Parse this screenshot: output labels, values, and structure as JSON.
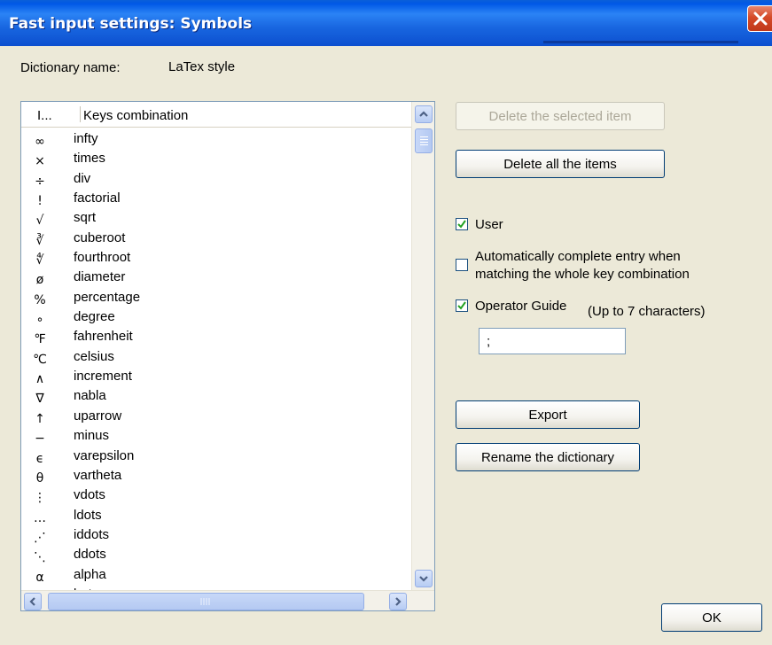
{
  "window": {
    "title": "Fast input settings: Symbols"
  },
  "dictionary": {
    "name_label": "Dictionary name:",
    "name_value": "LaTex style"
  },
  "list": {
    "columns": [
      "I...",
      "Keys combination"
    ],
    "rows": [
      {
        "symbol": "∞",
        "key": "infty"
      },
      {
        "symbol": "×",
        "key": "times"
      },
      {
        "symbol": "÷",
        "key": "div"
      },
      {
        "symbol": "!",
        "key": "factorial"
      },
      {
        "symbol": "√",
        "key": "sqrt"
      },
      {
        "symbol": "∛",
        "key": "cuberoot"
      },
      {
        "symbol": "∜",
        "key": "fourthroot"
      },
      {
        "symbol": "ø",
        "key": "diameter"
      },
      {
        "symbol": "%",
        "key": "percentage"
      },
      {
        "symbol": "∘",
        "key": "degree"
      },
      {
        "symbol": "℉",
        "key": "fahrenheit"
      },
      {
        "symbol": "℃",
        "key": "celsius"
      },
      {
        "symbol": "∧",
        "key": "increment"
      },
      {
        "symbol": "∇",
        "key": "nabla"
      },
      {
        "symbol": "↑",
        "key": "uparrow"
      },
      {
        "symbol": "−",
        "key": "minus"
      },
      {
        "symbol": "ϵ",
        "key": "varepsilon"
      },
      {
        "symbol": "θ",
        "key": "vartheta"
      },
      {
        "symbol": "⋮",
        "key": "vdots"
      },
      {
        "symbol": "…",
        "key": "ldots"
      },
      {
        "symbol": "⋰",
        "key": "iddots"
      },
      {
        "symbol": "⋱",
        "key": "ddots"
      },
      {
        "symbol": "α",
        "key": "alpha"
      },
      {
        "symbol": "β",
        "key": "beta"
      }
    ]
  },
  "buttons": {
    "delete_selected": "Delete the selected item",
    "delete_all": "Delete all the items",
    "export": "Export",
    "rename": "Rename the dictionary",
    "ok": "OK"
  },
  "options": {
    "user_label": "User",
    "user_checked": true,
    "auto_complete_line1": "Automatically complete entry when",
    "auto_complete_line2": "matching the whole key combination",
    "auto_complete_checked": false,
    "operator_guide_label": "Operator Guide",
    "operator_guide_checked": true,
    "operator_guide_hint": "(Up to 7 characters)",
    "operator_guide_value": ";"
  },
  "icons": {
    "close": "close-icon",
    "scroll_up": "arrow-up-icon",
    "scroll_down": "arrow-down-icon",
    "scroll_left": "arrow-left-icon",
    "scroll_right": "arrow-right-icon",
    "check": "check-icon"
  }
}
